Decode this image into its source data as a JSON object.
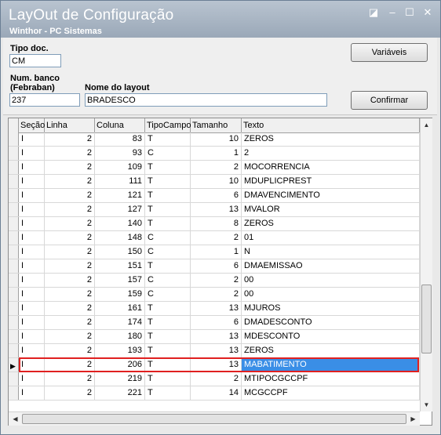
{
  "window": {
    "title": "LayOut de Configuração",
    "subtitle": "Winthor - PC Sistemas",
    "controls": {
      "restore": "◪",
      "minimize": "–",
      "maximize": "☐",
      "close": "✕"
    }
  },
  "form": {
    "tipo_doc_label": "Tipo doc.",
    "tipo_doc_value": "CM",
    "num_banco_label_1": "Num. banco",
    "num_banco_label_2": "(Febraban)",
    "num_banco_value": "237",
    "nome_layout_label": "Nome do layout",
    "nome_layout_value": "BRADESCO",
    "variaveis_button": "Variáveis",
    "confirmar_button": "Confirmar"
  },
  "grid": {
    "columns": [
      "Seção",
      "Linha",
      "Coluna",
      "TipoCampo",
      "Tamanho",
      "Texto"
    ],
    "rows": [
      [
        "I",
        "2",
        "83",
        "T",
        "10",
        "ZEROS"
      ],
      [
        "I",
        "2",
        "93",
        "C",
        "1",
        "2"
      ],
      [
        "I",
        "2",
        "109",
        "T",
        "2",
        "MOCORRENCIA"
      ],
      [
        "I",
        "2",
        "111",
        "T",
        "10",
        "MDUPLICPREST"
      ],
      [
        "I",
        "2",
        "121",
        "T",
        "6",
        "DMAVENCIMENTO"
      ],
      [
        "I",
        "2",
        "127",
        "T",
        "13",
        "MVALOR"
      ],
      [
        "I",
        "2",
        "140",
        "T",
        "8",
        "ZEROS"
      ],
      [
        "I",
        "2",
        "148",
        "C",
        "2",
        "01"
      ],
      [
        "I",
        "2",
        "150",
        "C",
        "1",
        "N"
      ],
      [
        "I",
        "2",
        "151",
        "T",
        "6",
        "DMAEMISSAO"
      ],
      [
        "I",
        "2",
        "157",
        "C",
        "2",
        "00"
      ],
      [
        "I",
        "2",
        "159",
        "C",
        "2",
        "00"
      ],
      [
        "I",
        "2",
        "161",
        "T",
        "13",
        "MJUROS"
      ],
      [
        "I",
        "2",
        "174",
        "T",
        "6",
        "DMADESCONTO"
      ],
      [
        "I",
        "2",
        "180",
        "T",
        "13",
        "MDESCONTO"
      ],
      [
        "I",
        "2",
        "193",
        "T",
        "13",
        "ZEROS"
      ],
      [
        "I",
        "2",
        "206",
        "T",
        "13",
        "MABATIMENTO"
      ],
      [
        "I",
        "2",
        "219",
        "T",
        "2",
        "MTIPOCGCCPF"
      ],
      [
        "I",
        "2",
        "221",
        "T",
        "14",
        "MCGCCPF"
      ]
    ],
    "selected_row_index": 16,
    "current_row_marker": "▶"
  },
  "scroll": {
    "up": "▲",
    "down": "▼",
    "left": "◀",
    "right": "▶"
  },
  "colors": {
    "selection": "#3a8ee6",
    "highlight_border": "#e02020"
  }
}
